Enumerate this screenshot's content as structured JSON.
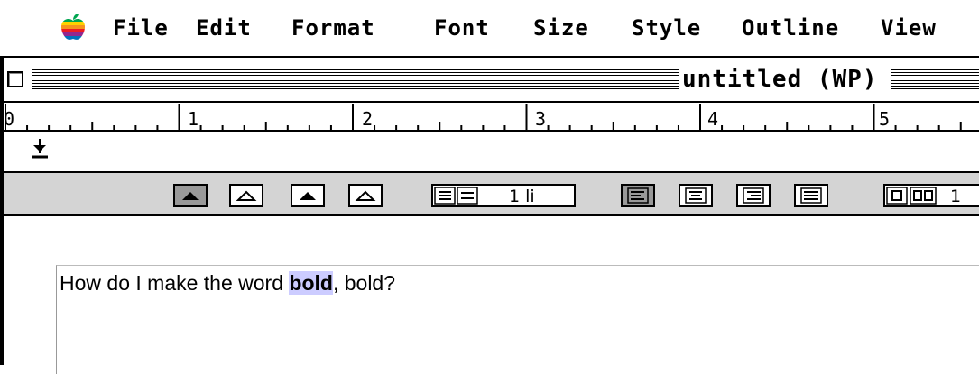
{
  "menubar": {
    "apple_icon": "apple-rainbow-logo",
    "items": [
      "File",
      "Edit",
      "Format",
      "Font",
      "Size",
      "Style",
      "Outline",
      "View"
    ]
  },
  "window": {
    "title": "untitled (WP)"
  },
  "ruler": {
    "labels": [
      "0",
      "1",
      "2",
      "3",
      "4",
      "5"
    ]
  },
  "toolbar": {
    "tab_stops": [
      "left-tab",
      "center-tab",
      "right-tab",
      "decimal-tab"
    ],
    "line_spacing": "1 li",
    "alignment": [
      "align-left",
      "align-center",
      "align-right",
      "justify"
    ],
    "columns_value": "1"
  },
  "document": {
    "text_before": "How do I make the word ",
    "selected_text": "bold",
    "text_after": ", bold?",
    "selection_color": "#ccccff"
  }
}
